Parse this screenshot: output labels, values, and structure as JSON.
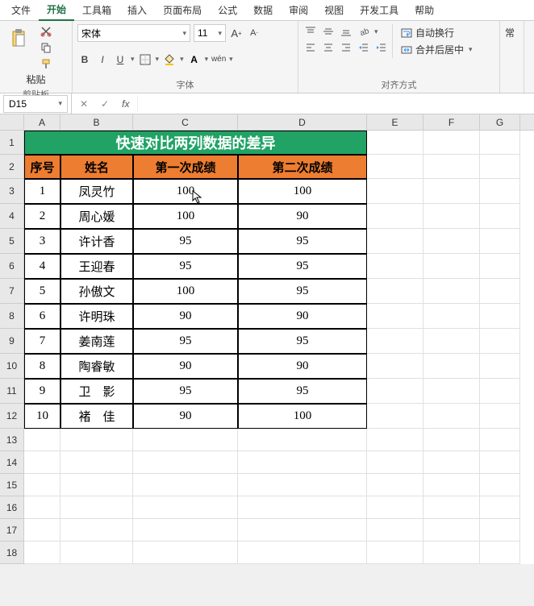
{
  "menu": {
    "items": [
      "文件",
      "开始",
      "工具箱",
      "插入",
      "页面布局",
      "公式",
      "数据",
      "审阅",
      "视图",
      "开发工具",
      "帮助"
    ],
    "active_index": 1
  },
  "ribbon": {
    "clipboard": {
      "paste": "粘贴",
      "label": "剪贴板"
    },
    "font": {
      "name": "宋体",
      "size": "11",
      "label": "字体",
      "bold": "B",
      "italic": "I",
      "underline": "U",
      "wen": "wén"
    },
    "align": {
      "label": "对齐方式",
      "wrap": "自动换行",
      "merge": "合并后居中"
    },
    "general": "常"
  },
  "formula_bar": {
    "cell_ref": "D15",
    "fx": "fx"
  },
  "columns": [
    "A",
    "B",
    "C",
    "D",
    "E",
    "F",
    "G"
  ],
  "title": "快速对比两列数据的差异",
  "headers": [
    "序号",
    "姓名",
    "第一次成绩",
    "第二次成绩"
  ],
  "rows": [
    {
      "n": "1",
      "name": "凤灵竹",
      "s1": "100",
      "s2": "100"
    },
    {
      "n": "2",
      "name": "周心媛",
      "s1": "100",
      "s2": "90"
    },
    {
      "n": "3",
      "name": "许计香",
      "s1": "95",
      "s2": "95"
    },
    {
      "n": "4",
      "name": "王迎春",
      "s1": "95",
      "s2": "95"
    },
    {
      "n": "5",
      "name": "孙傲文",
      "s1": "100",
      "s2": "95"
    },
    {
      "n": "6",
      "name": "许明珠",
      "s1": "90",
      "s2": "90"
    },
    {
      "n": "7",
      "name": "姜南莲",
      "s1": "95",
      "s2": "95"
    },
    {
      "n": "8",
      "name": "陶睿敏",
      "s1": "90",
      "s2": "90"
    },
    {
      "n": "9",
      "name": "卫　影",
      "s1": "95",
      "s2": "95"
    },
    {
      "n": "10",
      "name": "褚　佳",
      "s1": "90",
      "s2": "100"
    }
  ],
  "row_count_visible": 18,
  "row_heights": {
    "title": 30,
    "header": 30,
    "data": 31,
    "empty": 28
  }
}
